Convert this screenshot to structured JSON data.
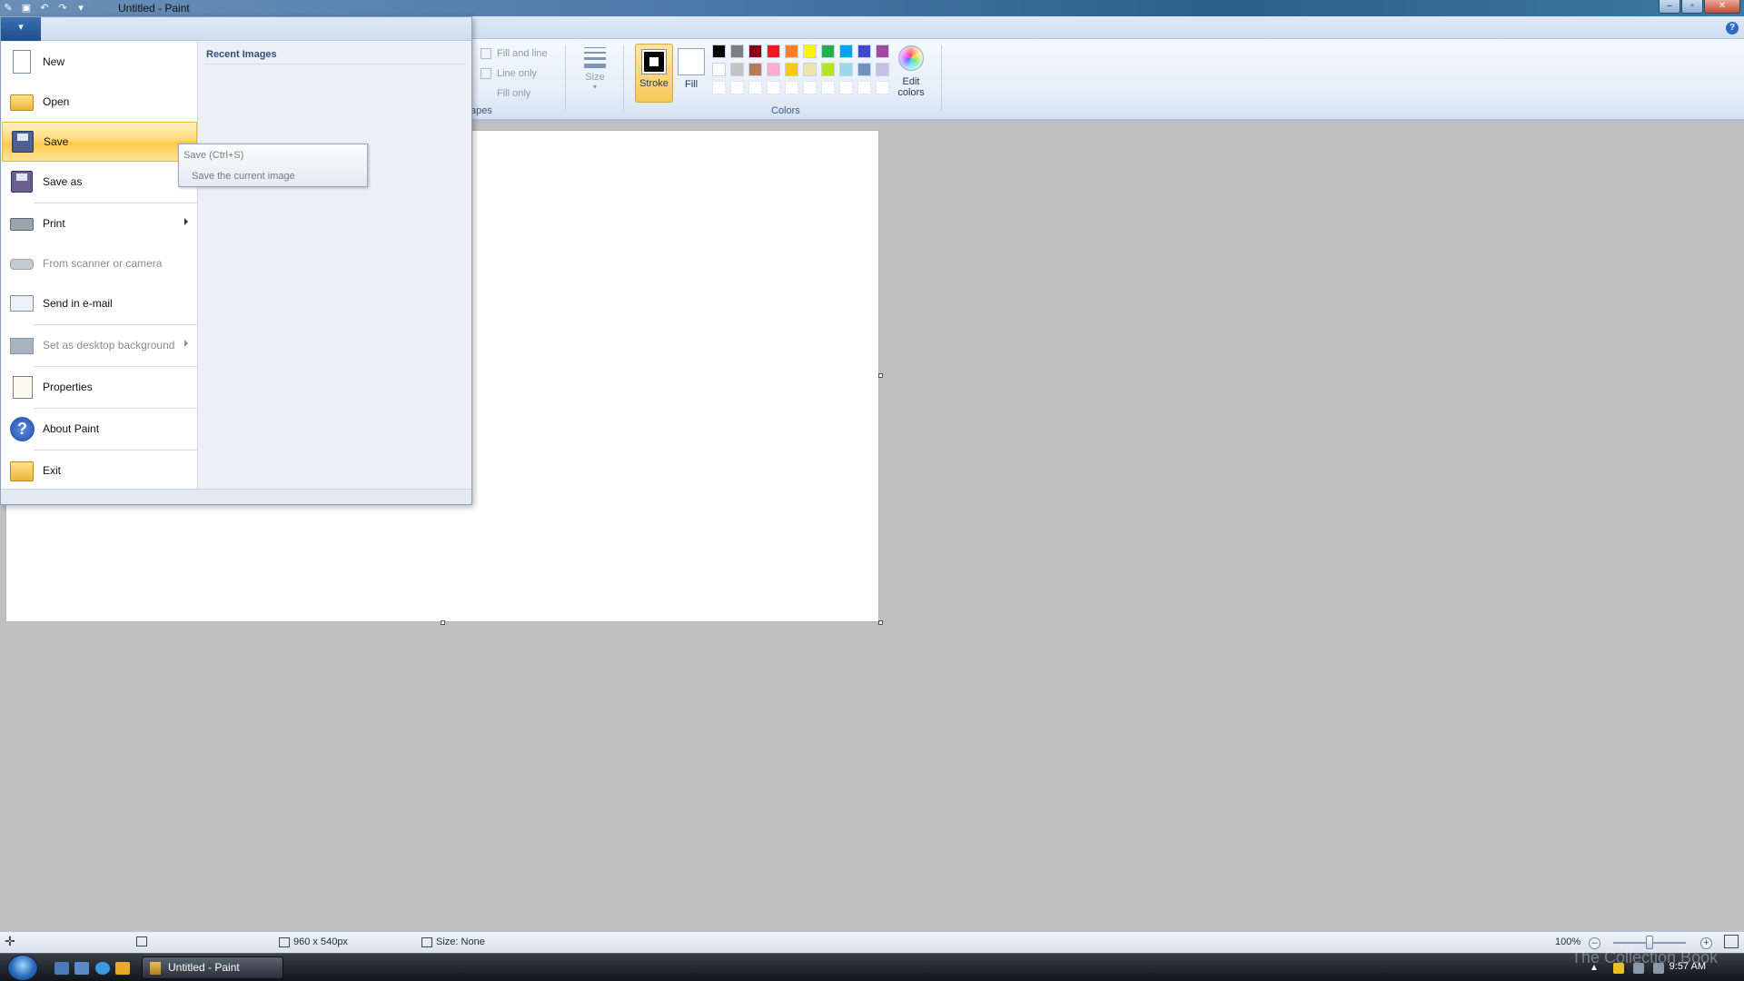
{
  "window": {
    "title": "Untitled - Paint"
  },
  "ribbon": {
    "shapes": {
      "group_label_partial": "apes",
      "options": [
        "Fill and line",
        "Line only",
        "Fill only"
      ]
    },
    "size_label": "Size",
    "colors": {
      "stroke_label": "Stroke",
      "fill_label": "Fill",
      "group_label": "Colors",
      "edit_colors_label_line1": "Edit",
      "edit_colors_label_line2": "colors",
      "palette_row1": [
        "#000000",
        "#7f7f7f",
        "#880015",
        "#ed1c24",
        "#ff7f27",
        "#fff200",
        "#22b14c",
        "#00a2e8",
        "#3f48cc",
        "#a349a4"
      ],
      "palette_row2": [
        "#ffffff",
        "#c3c3c3",
        "#b97a57",
        "#ffaec9",
        "#ffc90e",
        "#efe4b0",
        "#b5e61d",
        "#99d9ea",
        "#7092be",
        "#c8bfe7"
      ]
    }
  },
  "app_menu": {
    "items": [
      {
        "label": "New",
        "icon": "new-document-icon",
        "enabled": true
      },
      {
        "label": "Open",
        "icon": "folder-open-icon",
        "enabled": true
      },
      {
        "label": "Save",
        "icon": "floppy-disk-icon",
        "enabled": true,
        "highlighted": true
      },
      {
        "label": "Save as",
        "icon": "save-as-icon",
        "enabled": true
      },
      {
        "label": "Print",
        "icon": "printer-icon",
        "enabled": true,
        "submenu": true
      },
      {
        "label": "From scanner or camera",
        "icon": "scanner-icon",
        "enabled": false
      },
      {
        "label": "Send in e-mail",
        "icon": "email-icon",
        "enabled": true
      },
      {
        "label": "Set as desktop background",
        "icon": "desktop-background-icon",
        "enabled": false,
        "submenu": true
      },
      {
        "label": "Properties",
        "icon": "properties-icon",
        "enabled": true
      },
      {
        "label": "About Paint",
        "icon": "help-icon",
        "enabled": true
      },
      {
        "label": "Exit",
        "icon": "exit-icon",
        "enabled": true
      }
    ],
    "recent_title": "Recent Images"
  },
  "tooltip": {
    "title": "Save (Ctrl+S)",
    "body": "Save the current image"
  },
  "statusbar": {
    "image_size": "960 x 540px",
    "selection_size": "Size: None",
    "zoom": "100%"
  },
  "taskbar": {
    "active_window": "Untitled - Paint",
    "clock": "9:57 AM"
  },
  "watermark": "The Collection Book"
}
